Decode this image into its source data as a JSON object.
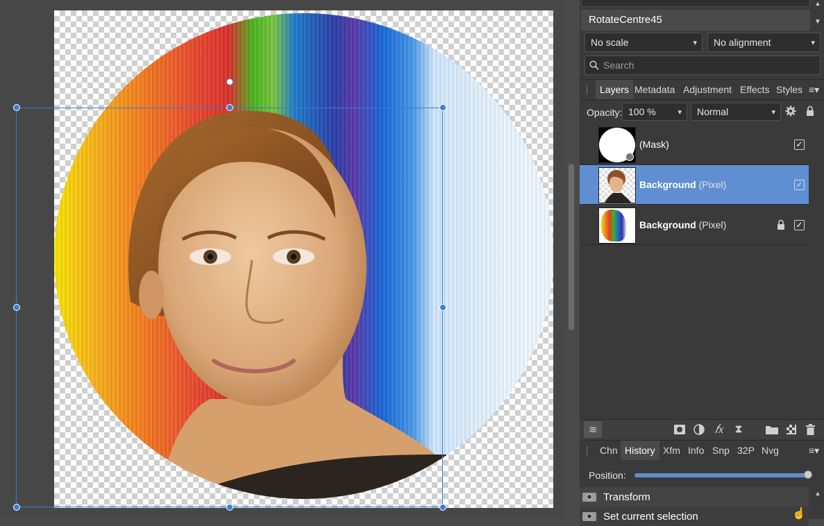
{
  "top": {
    "preset_name": "RotateCentre45",
    "scale_select": "No scale",
    "alignment_select": "No alignment",
    "search_placeholder": "Search"
  },
  "layers_tabs": [
    "Layers",
    "Metadata",
    "Adjustment",
    "Effects",
    "Styles"
  ],
  "layers_toolbar": {
    "opacity_label": "Opacity:",
    "opacity_value": "100 %",
    "blend_mode": "Normal"
  },
  "layers": [
    {
      "name": "(Mask)",
      "type": "",
      "visible": true,
      "locked": false,
      "selected": false
    },
    {
      "name": "Background",
      "type": "(Pixel)",
      "visible": true,
      "locked": false,
      "selected": true
    },
    {
      "name": "Background",
      "type": "(Pixel)",
      "visible": true,
      "locked": true,
      "selected": false
    }
  ],
  "bottom_tabs": [
    "Chn",
    "History",
    "Xfm",
    "Info",
    "Snp",
    "32P",
    "Nvg"
  ],
  "history": {
    "position_label": "Position:",
    "position_value": 1.0,
    "items": [
      "Transform",
      "Set current selection"
    ]
  },
  "colors": {
    "accent": "#5f8fd2",
    "handle": "#3b7fd9",
    "panel_bg": "#3a3a3a",
    "workspace_bg": "#474747"
  }
}
